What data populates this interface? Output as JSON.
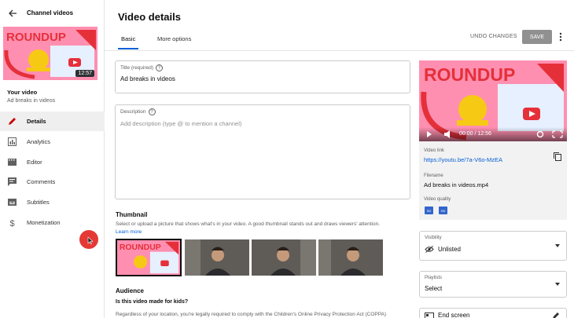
{
  "sidebar": {
    "title": "Channel videos",
    "thumb_duration": "12:57",
    "your_video_label": "Your video",
    "your_video_title": "Ad breaks in videos",
    "items": [
      {
        "label": "Details",
        "icon": "pencil-icon",
        "active": true
      },
      {
        "label": "Analytics",
        "icon": "bar-chart-icon",
        "active": false
      },
      {
        "label": "Editor",
        "icon": "film-icon",
        "active": false
      },
      {
        "label": "Comments",
        "icon": "comment-icon",
        "active": false
      },
      {
        "label": "Subtitles",
        "icon": "subtitles-icon",
        "active": false
      },
      {
        "label": "Monetization",
        "icon": "dollar-icon",
        "active": false
      }
    ]
  },
  "header": {
    "title": "Video details",
    "tabs": [
      {
        "label": "Basic",
        "active": true
      },
      {
        "label": "More options",
        "active": false
      }
    ],
    "undo_label": "UNDO CHANGES",
    "save_label": "SAVE"
  },
  "form": {
    "title_label": "Title (required)",
    "title_value": "Ad breaks in videos",
    "description_label": "Description",
    "description_placeholder": "Add description (type @ to mention a channel)",
    "thumbnail_heading": "Thumbnail",
    "thumbnail_help": "Select or upload a picture that shows what's in your video. A good thumbnail stands out and draws viewers' attention.",
    "learn_more": "Learn more",
    "audience_heading": "Audience",
    "audience_question": "Is this video made for kids?",
    "audience_text": "Regardless of your location, you're legally required to comply with the Children's Online Privacy Protection Act (COPPA)"
  },
  "preview": {
    "time": "00:00 / 12:56",
    "video_link_label": "Video link",
    "video_link": "https://youtu.be/7a-V6o-MzEA",
    "filename_label": "Filename",
    "filename": "Ad breaks in videos.mp4",
    "quality_label": "Video quality",
    "quality_badges": [
      "SD",
      "HD"
    ]
  },
  "visibility": {
    "label": "Visibility",
    "value": "Unlisted"
  },
  "playlists": {
    "label": "Playlists",
    "value": "Select"
  },
  "end_screen": {
    "label": "End screen"
  },
  "brand_text": "ROUNDUP",
  "colors": {
    "accent": "#065fd4",
    "brand_red": "#e5303a",
    "active_icon": "#cc0000"
  }
}
